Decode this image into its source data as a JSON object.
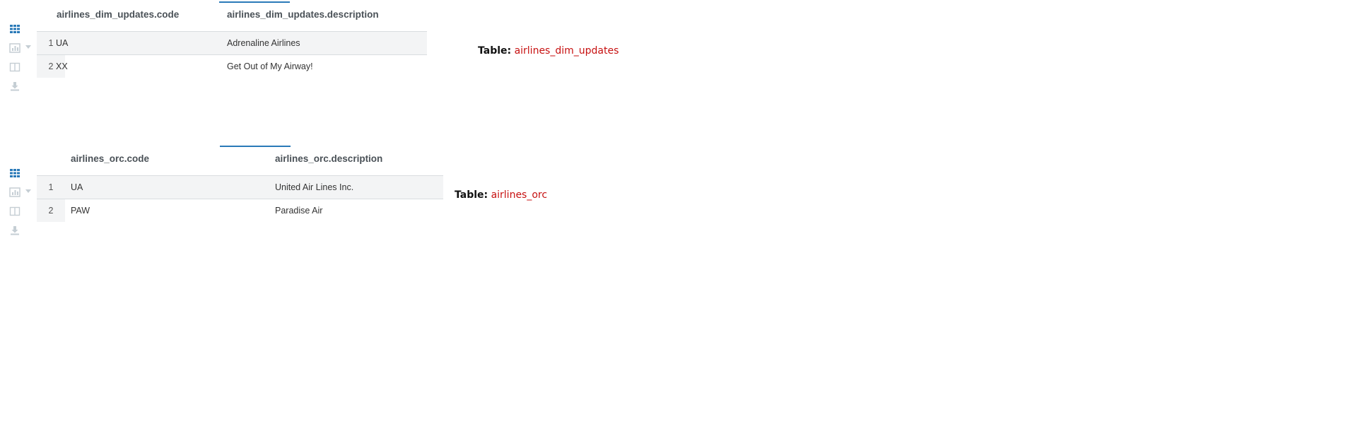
{
  "results": [
    {
      "columns": [
        "airlines_dim_updates.code",
        "airlines_dim_updates.description"
      ],
      "rows": [
        {
          "num": "1",
          "code": "UA",
          "description": "Adrenaline Airlines"
        },
        {
          "num": "2",
          "code": "XX",
          "description": "Get Out of My Airway!"
        }
      ],
      "caption_label": "Table:",
      "caption_name": "airlines_dim_updates"
    },
    {
      "columns": [
        "airlines_orc.code",
        "airlines_orc.description"
      ],
      "rows": [
        {
          "num": "1",
          "code": "UA",
          "description": "United Air Lines Inc."
        },
        {
          "num": "2",
          "code": "PAW",
          "description": "Paradise Air"
        }
      ],
      "caption_label": "Table:",
      "caption_name": "airlines_orc"
    }
  ],
  "toolbar": {
    "icons": [
      "grid-icon",
      "chart-icon",
      "columns-icon",
      "download-icon"
    ]
  },
  "colors": {
    "accent": "#2a7ab8",
    "table_name": "#c71111",
    "header_text": "#4a5157",
    "icon_inactive": "#c5ced4"
  }
}
